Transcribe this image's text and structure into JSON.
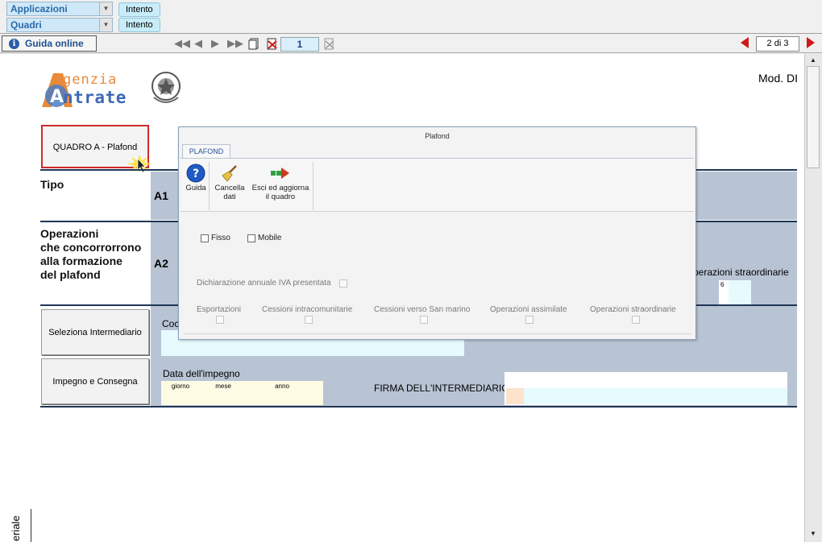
{
  "top_bar": {
    "applicazioni": "Applicazioni",
    "quadri": "Quadri",
    "chip_top": "Intento",
    "chip_bottom": "Intento"
  },
  "toolbar": {
    "guida_online": "Guida online",
    "info_glyph": "i",
    "page_number": "1",
    "page_of": "2 di 3"
  },
  "document": {
    "logo_line1": "genzia",
    "logo_line2": "ntrate",
    "logo_initial_a": "A",
    "mod_label": "Mod. DI",
    "quadro_button": "QUADRO A - Plafond",
    "tipo": "Tipo",
    "code_a1": "A1",
    "operazioni_title": [
      "Operazioni",
      "che concorrorrono",
      "alla formazione",
      "del plafond"
    ],
    "code_a2": "A2",
    "operazioni_straordinarie_partial": "perazioni straordinarie",
    "field_six": "6",
    "seleziona_button": "Seleziona Intermediario",
    "codice_partial": "Coc",
    "impegno_button": "Impegno e Consegna",
    "data_impegno": "Data dell'impegno",
    "giorno": "giorno",
    "mese": "mese",
    "anno": "anno",
    "firma": "FIRMA DELL'INTERMEDIARIO",
    "side_tab_partial": "eriale"
  },
  "modal": {
    "title": "Plafond",
    "tab": "PLAFOND",
    "ribbon": [
      {
        "label_line1": "Guida",
        "label_line2": "",
        "icon": "help-icon"
      },
      {
        "label_line1": "Cancella",
        "label_line2": "dati",
        "icon": "broom-icon"
      },
      {
        "label_line1": "Esci ed aggiorna",
        "label_line2": "il quadro",
        "icon": "exit-arrow-icon"
      }
    ],
    "fisso": "Fisso",
    "mobile": "Mobile",
    "dichiarazione": "Dichiarazione annuale IVA presentata",
    "esportazioni": "Esportazioni",
    "cessioni_intra": "Cessioni intracomunitarie",
    "cessioni_san_marino": "Cessioni verso San marino",
    "operazioni_assimilate": "Operazioni assimilate",
    "operazioni_straordinarie": "Operazioni straordinarie"
  },
  "colors": {
    "accent_blue": "#2a6aa8",
    "band_gray": "#b8c4d4",
    "rule_dark": "#1f3656",
    "nav_red": "#d01818"
  }
}
